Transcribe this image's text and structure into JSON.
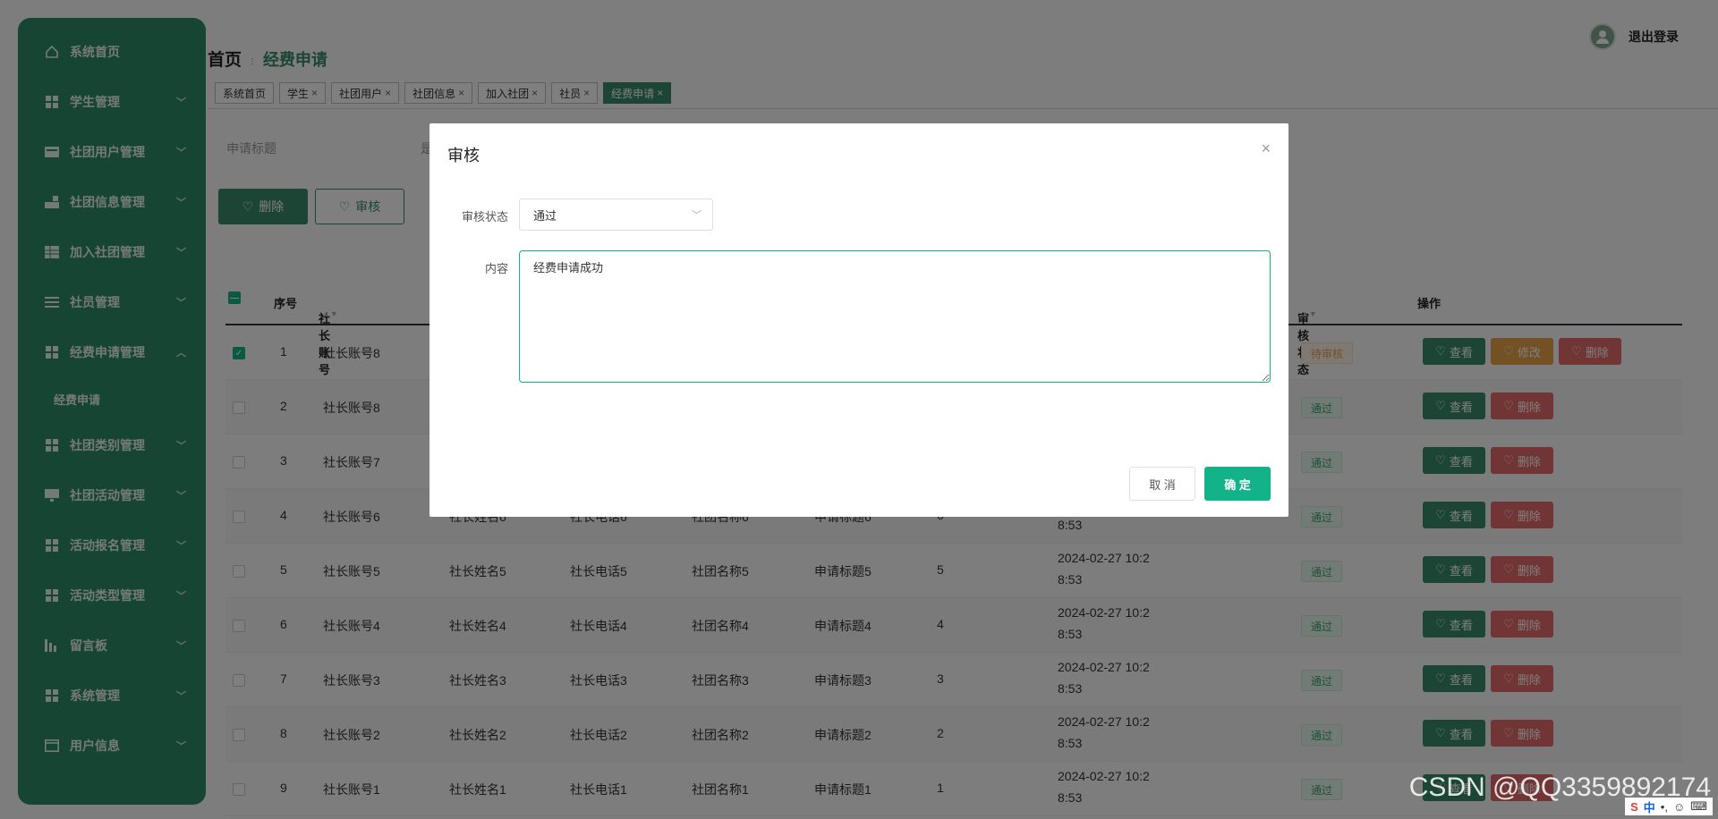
{
  "sidebar": {
    "items": [
      {
        "label": "系统首页",
        "icon": "home-icon"
      },
      {
        "label": "学生管理",
        "icon": "grid-icon"
      },
      {
        "label": "社团用户管理",
        "icon": "card-icon"
      },
      {
        "label": "社团信息管理",
        "icon": "chart-icon"
      },
      {
        "label": "加入社团管理",
        "icon": "table-icon"
      },
      {
        "label": "社员管理",
        "icon": "list-icon"
      },
      {
        "label": "经费申请管理",
        "icon": "grid-icon",
        "expanded": true
      },
      {
        "label": "社团类别管理",
        "icon": "grid-icon"
      },
      {
        "label": "社团活动管理",
        "icon": "monitor-icon"
      },
      {
        "label": "活动报名管理",
        "icon": "grid-icon"
      },
      {
        "label": "活动类型管理",
        "icon": "grid-icon"
      },
      {
        "label": "留言板",
        "icon": "bar-icon"
      },
      {
        "label": "系统管理",
        "icon": "grid-icon"
      },
      {
        "label": "用户信息",
        "icon": "window-icon"
      }
    ],
    "sub_item": "经费申请"
  },
  "header": {
    "home": "首页",
    "separator": "⁝",
    "current": "经费申请",
    "logout": "退出登录"
  },
  "tabs": [
    {
      "label": "系统首页",
      "closable": false
    },
    {
      "label": "学生",
      "closable": true
    },
    {
      "label": "社团用户",
      "closable": true
    },
    {
      "label": "社团信息",
      "closable": true
    },
    {
      "label": "加入社团",
      "closable": true
    },
    {
      "label": "社员",
      "closable": true
    },
    {
      "label": "经费申请",
      "closable": true,
      "active": true
    }
  ],
  "search": {
    "label1": "申请标题",
    "label2": "是"
  },
  "actions": {
    "delete": "删除",
    "audit": "审核"
  },
  "table": {
    "headers": {
      "index": "序号",
      "account": "社长账号",
      "status": "审核状态",
      "ops": "操作"
    },
    "rows": [
      {
        "idx": "1",
        "account": "社长账号8",
        "name": "",
        "phone": "",
        "club": "",
        "title": "",
        "amount": "",
        "date1": "",
        "date2": "",
        "status": "待审核",
        "status_type": "pending",
        "checked": true,
        "edit": true
      },
      {
        "idx": "2",
        "account": "社长账号8",
        "name": "",
        "phone": "",
        "club": "",
        "title": "",
        "amount": "",
        "date1": "",
        "date2": "",
        "status": "通过",
        "status_type": "pass",
        "checked": false,
        "edit": false
      },
      {
        "idx": "3",
        "account": "社长账号7",
        "name": "",
        "phone": "",
        "club": "",
        "title": "",
        "amount": "",
        "date1": "",
        "date2": "",
        "status": "通过",
        "status_type": "pass",
        "checked": false,
        "edit": false
      },
      {
        "idx": "4",
        "account": "社长账号6",
        "name": "社长姓名6",
        "phone": "社长电话6",
        "club": "社团名称6",
        "title": "申请标题6",
        "amount": "6",
        "date1": "",
        "date2": "8:53",
        "status": "通过",
        "status_type": "pass",
        "checked": false,
        "edit": false
      },
      {
        "idx": "5",
        "account": "社长账号5",
        "name": "社长姓名5",
        "phone": "社长电话5",
        "club": "社团名称5",
        "title": "申请标题5",
        "amount": "5",
        "date1": "2024-02-27 10:2",
        "date2": "8:53",
        "status": "通过",
        "status_type": "pass",
        "checked": false,
        "edit": false
      },
      {
        "idx": "6",
        "account": "社长账号4",
        "name": "社长姓名4",
        "phone": "社长电话4",
        "club": "社团名称4",
        "title": "申请标题4",
        "amount": "4",
        "date1": "2024-02-27 10:2",
        "date2": "8:53",
        "status": "通过",
        "status_type": "pass",
        "checked": false,
        "edit": false
      },
      {
        "idx": "7",
        "account": "社长账号3",
        "name": "社长姓名3",
        "phone": "社长电话3",
        "club": "社团名称3",
        "title": "申请标题3",
        "amount": "3",
        "date1": "2024-02-27 10:2",
        "date2": "8:53",
        "status": "通过",
        "status_type": "pass",
        "checked": false,
        "edit": false
      },
      {
        "idx": "8",
        "account": "社长账号2",
        "name": "社长姓名2",
        "phone": "社长电话2",
        "club": "社团名称2",
        "title": "申请标题2",
        "amount": "2",
        "date1": "2024-02-27 10:2",
        "date2": "8:53",
        "status": "通过",
        "status_type": "pass",
        "checked": false,
        "edit": false
      },
      {
        "idx": "9",
        "account": "社长账号1",
        "name": "社长姓名1",
        "phone": "社长电话1",
        "club": "社团名称1",
        "title": "申请标题1",
        "amount": "1",
        "date1": "2024-02-27 10:2",
        "date2": "8:53",
        "status": "通过",
        "status_type": "pass",
        "checked": false,
        "edit": false
      }
    ],
    "op_labels": {
      "view": "查看",
      "edit": "修改",
      "del": "删除"
    }
  },
  "dialog": {
    "title": "审核",
    "close": "×",
    "status_label": "审核状态",
    "status_value": "通过",
    "content_label": "内容",
    "content_value": "经费申请成功",
    "cancel": "取 消",
    "ok": "确 定"
  },
  "watermark": "CSDN @QQ3359892174",
  "ime": {
    "s": "S",
    "lang": "中",
    "punct": "•,",
    "emoji": "☺",
    "kbd": "⌨"
  },
  "colors": {
    "primary": "#3a8b6a",
    "accent": "#13b38a",
    "warning": "#e8a04a",
    "danger": "#e46a6a"
  }
}
